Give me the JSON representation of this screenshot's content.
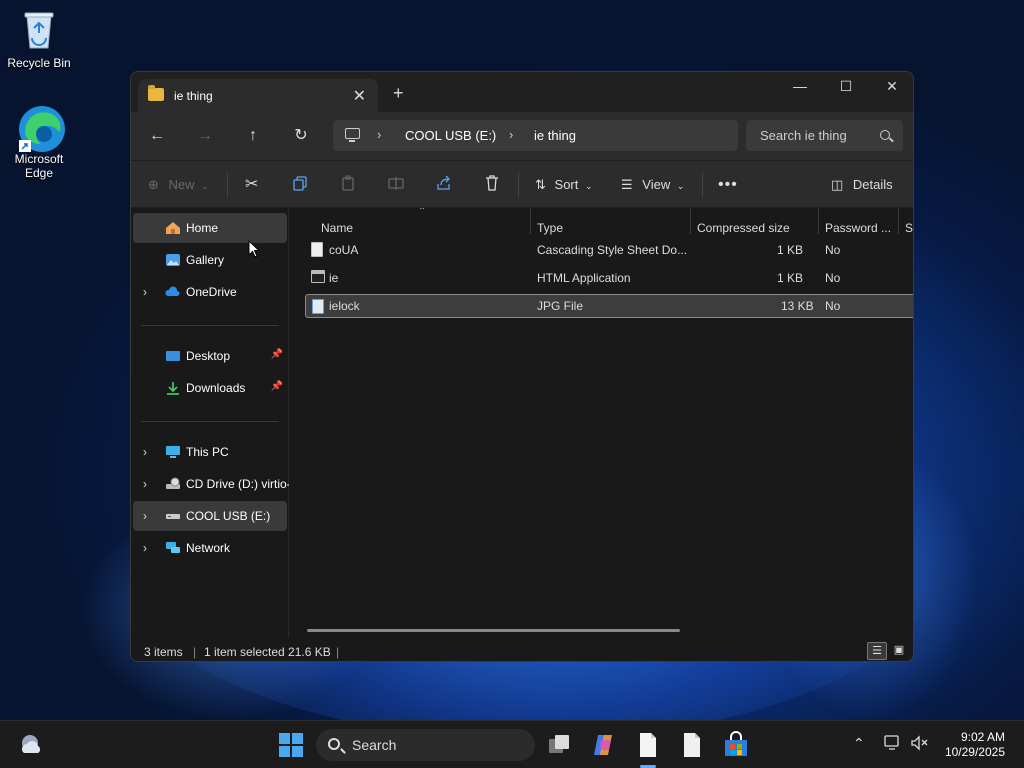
{
  "desktop": {
    "icons": [
      {
        "label": "Recycle Bin"
      },
      {
        "label": "Microsoft Edge"
      }
    ]
  },
  "window": {
    "tab_title": "ie thing",
    "address": {
      "crumbs": [
        "COOL USB (E:)",
        "ie thing"
      ]
    },
    "search": {
      "placeholder": "Search ie thing"
    },
    "toolbar": {
      "new_label": "New",
      "sort_label": "Sort",
      "view_label": "View",
      "details_label": "Details"
    },
    "sidebar": {
      "items": [
        {
          "label": "Home"
        },
        {
          "label": "Gallery"
        },
        {
          "label": "OneDrive"
        },
        {
          "label": "Desktop"
        },
        {
          "label": "Downloads"
        },
        {
          "label": "This PC"
        },
        {
          "label": "CD Drive (D:) virtio-"
        },
        {
          "label": "COOL USB (E:)"
        },
        {
          "label": "Network"
        }
      ]
    },
    "columns": [
      "Name",
      "Type",
      "Compressed size",
      "Password ...",
      "Si"
    ],
    "files": [
      {
        "name": "coUA",
        "type": "Cascading Style Sheet Do...",
        "size": "1 KB",
        "password": "No"
      },
      {
        "name": "ie",
        "type": "HTML Application",
        "size": "1 KB",
        "password": "No"
      },
      {
        "name": "ielock",
        "type": "JPG File",
        "size": "13 KB",
        "password": "No"
      }
    ],
    "status": {
      "items": "3 items",
      "selected": "1 item selected  21.6 KB"
    }
  },
  "taskbar": {
    "search_label": "Search",
    "time": "9:02 AM",
    "date": "10/29/2025"
  }
}
